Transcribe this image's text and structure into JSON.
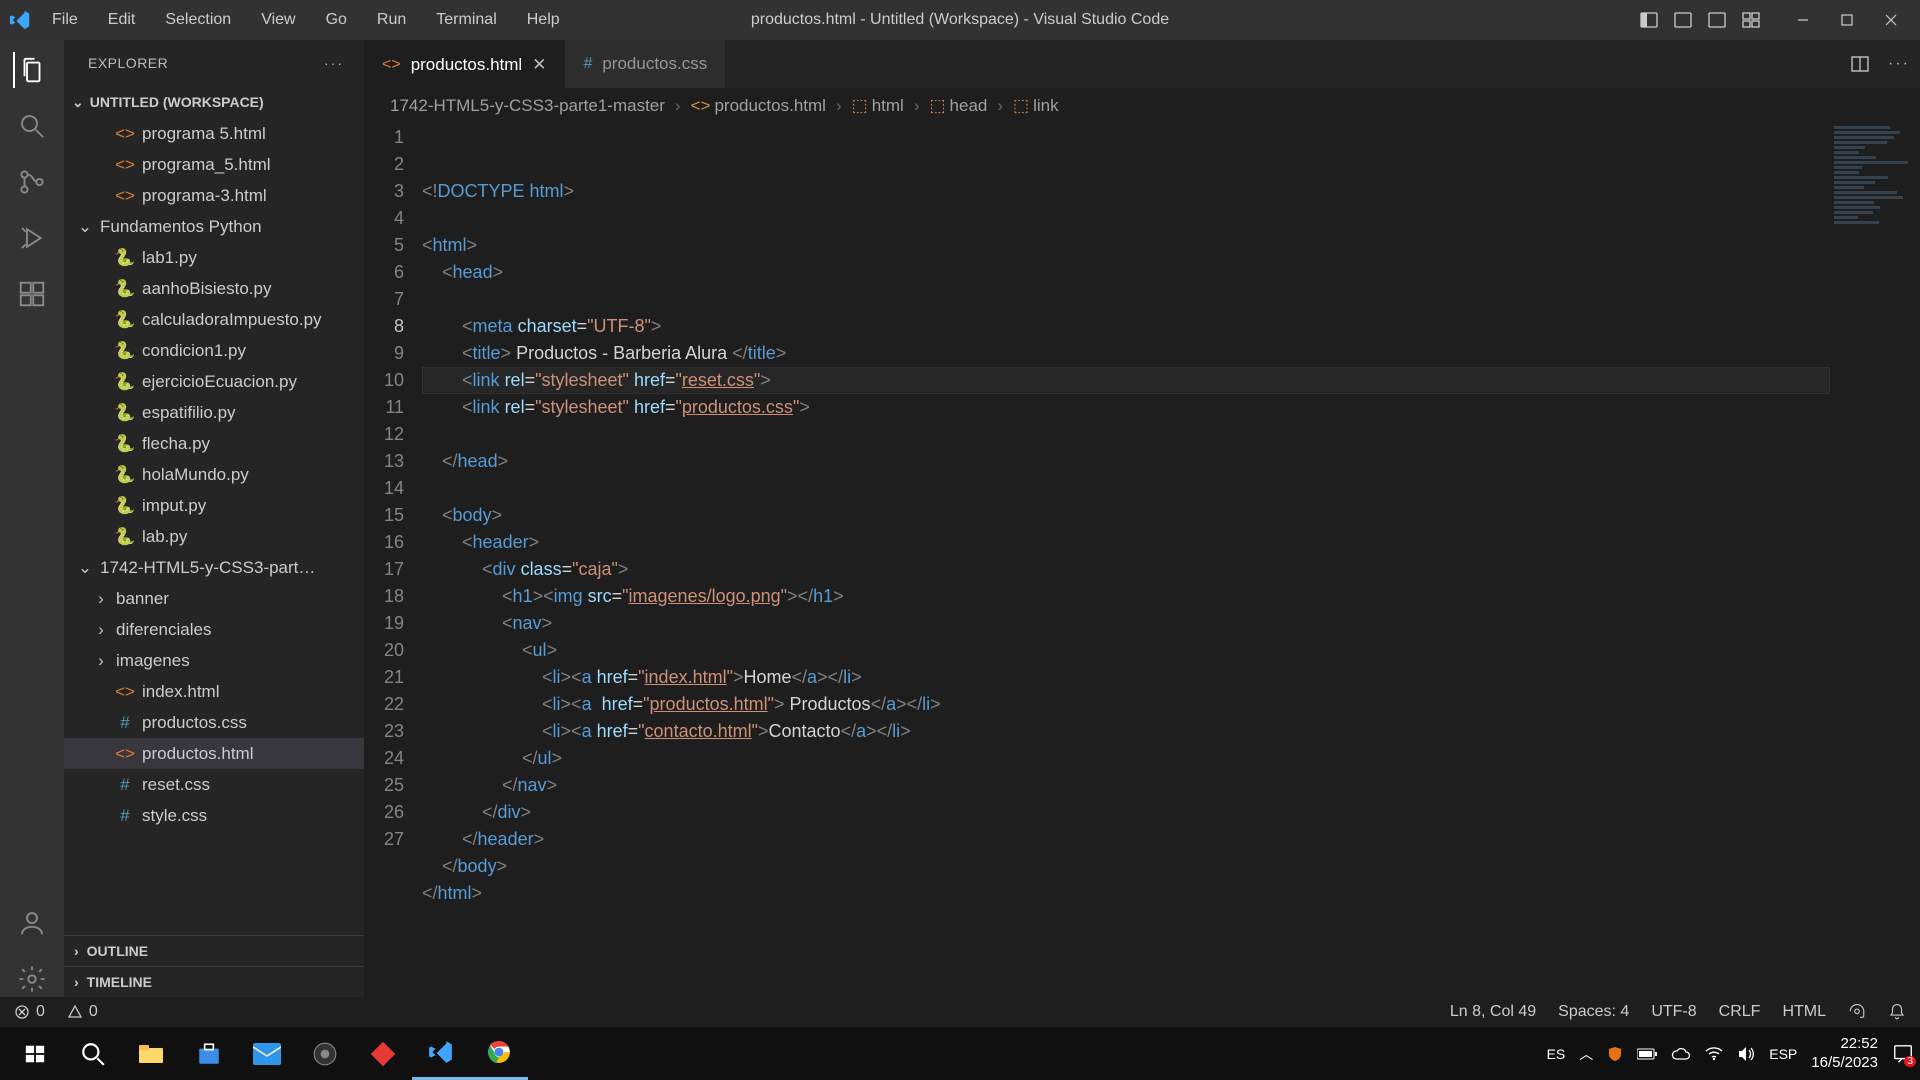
{
  "titlebar": {
    "title": "productos.html - Untitled (Workspace) - Visual Studio Code",
    "menu": [
      "File",
      "Edit",
      "Selection",
      "View",
      "Go",
      "Run",
      "Terminal",
      "Help"
    ]
  },
  "activity": {
    "items": [
      "explorer",
      "search",
      "scm",
      "debug",
      "extensions"
    ]
  },
  "sidebar": {
    "header": "EXPLORER",
    "workspace": "UNTITLED (WORKSPACE)",
    "tree": [
      {
        "type": "file",
        "icon": "html",
        "name": "programa 5.html",
        "indent": 1
      },
      {
        "type": "file",
        "icon": "html",
        "name": "programa_5.html",
        "indent": 1
      },
      {
        "type": "file",
        "icon": "html",
        "name": "programa-3.html",
        "indent": 1
      },
      {
        "type": "folder-open",
        "name": "Fundamentos Python",
        "indent": 0
      },
      {
        "type": "file",
        "icon": "py",
        "name": "lab1.py",
        "indent": 1
      },
      {
        "type": "file",
        "icon": "py",
        "name": "aanhoBisiesto.py",
        "indent": 1
      },
      {
        "type": "file",
        "icon": "py",
        "name": "calculadoraImpuesto.py",
        "indent": 1
      },
      {
        "type": "file",
        "icon": "py",
        "name": "condicion1.py",
        "indent": 1
      },
      {
        "type": "file",
        "icon": "py",
        "name": "ejercicioEcuacion.py",
        "indent": 1
      },
      {
        "type": "file",
        "icon": "py",
        "name": "espatifilio.py",
        "indent": 1
      },
      {
        "type": "file",
        "icon": "py",
        "name": "flecha.py",
        "indent": 1
      },
      {
        "type": "file",
        "icon": "py",
        "name": "holaMundo.py",
        "indent": 1
      },
      {
        "type": "file",
        "icon": "py",
        "name": "imput.py",
        "indent": 1
      },
      {
        "type": "file",
        "icon": "py",
        "name": "lab.py",
        "indent": 1
      },
      {
        "type": "folder-open",
        "name": "1742-HTML5-y-CSS3-part…",
        "indent": 0
      },
      {
        "type": "folder",
        "name": "banner",
        "indent": 1
      },
      {
        "type": "folder",
        "name": "diferenciales",
        "indent": 1
      },
      {
        "type": "folder",
        "name": "imagenes",
        "indent": 1
      },
      {
        "type": "file",
        "icon": "html",
        "name": "index.html",
        "indent": 1
      },
      {
        "type": "file",
        "icon": "css",
        "name": "productos.css",
        "indent": 1
      },
      {
        "type": "file",
        "icon": "html",
        "name": "productos.html",
        "indent": 1,
        "selected": true
      },
      {
        "type": "file",
        "icon": "css",
        "name": "reset.css",
        "indent": 1
      },
      {
        "type": "file",
        "icon": "css",
        "name": "style.css",
        "indent": 1
      }
    ],
    "outline": "OUTLINE",
    "timeline": "TIMELINE"
  },
  "tabs": [
    {
      "icon": "html",
      "label": "productos.html",
      "active": true,
      "close": true
    },
    {
      "icon": "css",
      "label": "productos.css",
      "active": false,
      "close": false
    }
  ],
  "breadcrumbs": [
    "1742-HTML5-y-CSS3-parte1-master",
    "productos.html",
    "html",
    "head",
    "link"
  ],
  "code": {
    "cursor_line": 8,
    "lines": [
      [
        {
          "c": "gray",
          "t": "<!"
        },
        {
          "c": "doctype",
          "t": "DOCTYPE"
        },
        {
          "c": "txt",
          "t": " "
        },
        {
          "c": "tag",
          "t": "html"
        },
        {
          "c": "gray",
          "t": ">"
        }
      ],
      [],
      [
        {
          "c": "gray",
          "t": "<"
        },
        {
          "c": "tag",
          "t": "html"
        },
        {
          "c": "gray",
          "t": ">"
        }
      ],
      [
        {
          "c": "txt",
          "t": "    "
        },
        {
          "c": "gray",
          "t": "<"
        },
        {
          "c": "tag",
          "t": "head"
        },
        {
          "c": "gray",
          "t": ">"
        }
      ],
      [],
      [
        {
          "c": "txt",
          "t": "        "
        },
        {
          "c": "gray",
          "t": "<"
        },
        {
          "c": "tag",
          "t": "meta"
        },
        {
          "c": "txt",
          "t": " "
        },
        {
          "c": "attr",
          "t": "charset"
        },
        {
          "c": "txt",
          "t": "="
        },
        {
          "c": "str",
          "t": "\"UTF-8\""
        },
        {
          "c": "gray",
          "t": ">"
        }
      ],
      [
        {
          "c": "txt",
          "t": "        "
        },
        {
          "c": "gray",
          "t": "<"
        },
        {
          "c": "tag",
          "t": "title"
        },
        {
          "c": "gray",
          "t": ">"
        },
        {
          "c": "txt",
          "t": " Productos - Barberia Alura "
        },
        {
          "c": "gray",
          "t": "</"
        },
        {
          "c": "tag",
          "t": "title"
        },
        {
          "c": "gray",
          "t": ">"
        }
      ],
      [
        {
          "c": "txt",
          "t": "        "
        },
        {
          "c": "gray",
          "t": "<"
        },
        {
          "c": "tag",
          "t": "link"
        },
        {
          "c": "txt",
          "t": " "
        },
        {
          "c": "attr",
          "t": "rel"
        },
        {
          "c": "txt",
          "t": "="
        },
        {
          "c": "str",
          "t": "\"stylesheet\""
        },
        {
          "c": "txt",
          "t": " "
        },
        {
          "c": "attr",
          "t": "href"
        },
        {
          "c": "txt",
          "t": "="
        },
        {
          "c": "str",
          "t": "\""
        },
        {
          "c": "str",
          "t": "reset.css",
          "u": 1
        },
        {
          "c": "str",
          "t": "\""
        },
        {
          "c": "gray",
          "t": ">"
        }
      ],
      [
        {
          "c": "txt",
          "t": "        "
        },
        {
          "c": "gray",
          "t": "<"
        },
        {
          "c": "tag",
          "t": "link"
        },
        {
          "c": "txt",
          "t": " "
        },
        {
          "c": "attr",
          "t": "rel"
        },
        {
          "c": "txt",
          "t": "="
        },
        {
          "c": "str",
          "t": "\"stylesheet\""
        },
        {
          "c": "txt",
          "t": " "
        },
        {
          "c": "attr",
          "t": "href"
        },
        {
          "c": "txt",
          "t": "="
        },
        {
          "c": "str",
          "t": "\""
        },
        {
          "c": "str",
          "t": "productos.css",
          "u": 1
        },
        {
          "c": "str",
          "t": "\""
        },
        {
          "c": "gray",
          "t": ">"
        }
      ],
      [],
      [
        {
          "c": "txt",
          "t": "    "
        },
        {
          "c": "gray",
          "t": "</"
        },
        {
          "c": "tag",
          "t": "head"
        },
        {
          "c": "gray",
          "t": ">"
        }
      ],
      [],
      [
        {
          "c": "txt",
          "t": "    "
        },
        {
          "c": "gray",
          "t": "<"
        },
        {
          "c": "tag",
          "t": "body"
        },
        {
          "c": "gray",
          "t": ">"
        }
      ],
      [
        {
          "c": "txt",
          "t": "        "
        },
        {
          "c": "gray",
          "t": "<"
        },
        {
          "c": "tag",
          "t": "header"
        },
        {
          "c": "gray",
          "t": ">"
        }
      ],
      [
        {
          "c": "txt",
          "t": "            "
        },
        {
          "c": "gray",
          "t": "<"
        },
        {
          "c": "tag",
          "t": "div"
        },
        {
          "c": "txt",
          "t": " "
        },
        {
          "c": "attr",
          "t": "class"
        },
        {
          "c": "txt",
          "t": "="
        },
        {
          "c": "str",
          "t": "\"caja\""
        },
        {
          "c": "gray",
          "t": ">"
        }
      ],
      [
        {
          "c": "txt",
          "t": "                "
        },
        {
          "c": "gray",
          "t": "<"
        },
        {
          "c": "tag",
          "t": "h1"
        },
        {
          "c": "gray",
          "t": "><"
        },
        {
          "c": "tag",
          "t": "img"
        },
        {
          "c": "txt",
          "t": " "
        },
        {
          "c": "attr",
          "t": "src"
        },
        {
          "c": "txt",
          "t": "="
        },
        {
          "c": "str",
          "t": "\""
        },
        {
          "c": "str",
          "t": "imagenes/logo.png",
          "u": 1
        },
        {
          "c": "str",
          "t": "\""
        },
        {
          "c": "gray",
          "t": "></"
        },
        {
          "c": "tag",
          "t": "h1"
        },
        {
          "c": "gray",
          "t": ">"
        }
      ],
      [
        {
          "c": "txt",
          "t": "                "
        },
        {
          "c": "gray",
          "t": "<"
        },
        {
          "c": "tag",
          "t": "nav"
        },
        {
          "c": "gray",
          "t": ">"
        }
      ],
      [
        {
          "c": "txt",
          "t": "                    "
        },
        {
          "c": "gray",
          "t": "<"
        },
        {
          "c": "tag",
          "t": "ul"
        },
        {
          "c": "gray",
          "t": ">"
        }
      ],
      [
        {
          "c": "txt",
          "t": "                        "
        },
        {
          "c": "gray",
          "t": "<"
        },
        {
          "c": "tag",
          "t": "li"
        },
        {
          "c": "gray",
          "t": "><"
        },
        {
          "c": "tag",
          "t": "a"
        },
        {
          "c": "txt",
          "t": " "
        },
        {
          "c": "attr",
          "t": "href"
        },
        {
          "c": "txt",
          "t": "="
        },
        {
          "c": "str",
          "t": "\""
        },
        {
          "c": "str",
          "t": "index.html",
          "u": 1
        },
        {
          "c": "str",
          "t": "\""
        },
        {
          "c": "gray",
          "t": ">"
        },
        {
          "c": "txt",
          "t": "Home"
        },
        {
          "c": "gray",
          "t": "</"
        },
        {
          "c": "tag",
          "t": "a"
        },
        {
          "c": "gray",
          "t": "></"
        },
        {
          "c": "tag",
          "t": "li"
        },
        {
          "c": "gray",
          "t": ">"
        }
      ],
      [
        {
          "c": "txt",
          "t": "                        "
        },
        {
          "c": "gray",
          "t": "<"
        },
        {
          "c": "tag",
          "t": "li"
        },
        {
          "c": "gray",
          "t": "><"
        },
        {
          "c": "tag",
          "t": "a"
        },
        {
          "c": "txt",
          "t": "  "
        },
        {
          "c": "attr",
          "t": "href"
        },
        {
          "c": "txt",
          "t": "="
        },
        {
          "c": "str",
          "t": "\""
        },
        {
          "c": "str",
          "t": "productos.html",
          "u": 1
        },
        {
          "c": "str",
          "t": "\""
        },
        {
          "c": "gray",
          "t": ">"
        },
        {
          "c": "txt",
          "t": " Productos"
        },
        {
          "c": "gray",
          "t": "</"
        },
        {
          "c": "tag",
          "t": "a"
        },
        {
          "c": "gray",
          "t": "></"
        },
        {
          "c": "tag",
          "t": "li"
        },
        {
          "c": "gray",
          "t": ">"
        }
      ],
      [
        {
          "c": "txt",
          "t": "                        "
        },
        {
          "c": "gray",
          "t": "<"
        },
        {
          "c": "tag",
          "t": "li"
        },
        {
          "c": "gray",
          "t": "><"
        },
        {
          "c": "tag",
          "t": "a"
        },
        {
          "c": "txt",
          "t": " "
        },
        {
          "c": "attr",
          "t": "href"
        },
        {
          "c": "txt",
          "t": "="
        },
        {
          "c": "str",
          "t": "\""
        },
        {
          "c": "str",
          "t": "contacto.html",
          "u": 1
        },
        {
          "c": "str",
          "t": "\""
        },
        {
          "c": "gray",
          "t": ">"
        },
        {
          "c": "txt",
          "t": "Contacto"
        },
        {
          "c": "gray",
          "t": "</"
        },
        {
          "c": "tag",
          "t": "a"
        },
        {
          "c": "gray",
          "t": "></"
        },
        {
          "c": "tag",
          "t": "li"
        },
        {
          "c": "gray",
          "t": ">"
        }
      ],
      [
        {
          "c": "txt",
          "t": "                    "
        },
        {
          "c": "gray",
          "t": "</"
        },
        {
          "c": "tag",
          "t": "ul"
        },
        {
          "c": "gray",
          "t": ">"
        }
      ],
      [
        {
          "c": "txt",
          "t": "                "
        },
        {
          "c": "gray",
          "t": "</"
        },
        {
          "c": "tag",
          "t": "nav"
        },
        {
          "c": "gray",
          "t": ">"
        }
      ],
      [
        {
          "c": "txt",
          "t": "            "
        },
        {
          "c": "gray",
          "t": "</"
        },
        {
          "c": "tag",
          "t": "div"
        },
        {
          "c": "gray",
          "t": ">"
        }
      ],
      [
        {
          "c": "txt",
          "t": "        "
        },
        {
          "c": "gray",
          "t": "</"
        },
        {
          "c": "tag",
          "t": "header"
        },
        {
          "c": "gray",
          "t": ">"
        }
      ],
      [
        {
          "c": "txt",
          "t": "    "
        },
        {
          "c": "gray",
          "t": "</"
        },
        {
          "c": "tag",
          "t": "body"
        },
        {
          "c": "gray",
          "t": ">"
        }
      ],
      [
        {
          "c": "gray",
          "t": "</"
        },
        {
          "c": "tag",
          "t": "html"
        },
        {
          "c": "gray",
          "t": ">"
        }
      ]
    ]
  },
  "status": {
    "errors": "0",
    "warnings": "0",
    "lncol": "Ln 8, Col 49",
    "spaces": "Spaces: 4",
    "encoding": "UTF-8",
    "eol": "CRLF",
    "lang": "HTML"
  },
  "taskbar": {
    "lang": "ES",
    "ime": "ESP",
    "time": "22:52",
    "date": "16/5/2023",
    "notif": "3"
  }
}
